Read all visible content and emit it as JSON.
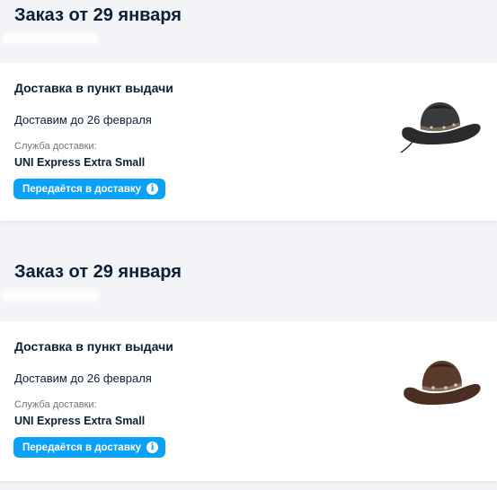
{
  "orders": [
    {
      "title": "Заказ от 29 января",
      "delivery_type": "Доставка в пункт выдачи",
      "delivery_date": "Доставим до 26 февраля",
      "service_label": "Служба доставки:",
      "service_name": "UNI Express Extra Small",
      "status": "Передаётся в доставку",
      "product_icon": "cowboy-hat-black",
      "product_color": "#2b2b2d"
    },
    {
      "title": "Заказ от 29 января",
      "delivery_type": "Доставка в пункт выдачи",
      "delivery_date": "Доставим до 26 февраля",
      "service_label": "Служба доставки:",
      "service_name": "UNI Express Extra Small",
      "status": "Передаётся в доставку",
      "product_icon": "cowboy-hat-brown",
      "product_color": "#4a2e22"
    }
  ],
  "colors": {
    "accent": "#0aa2f5",
    "page_background": "#f3f4f8",
    "card_background": "#ffffff",
    "text_primary": "#0b1f35",
    "text_secondary": "#6b7583"
  },
  "status_icon": "info-icon"
}
